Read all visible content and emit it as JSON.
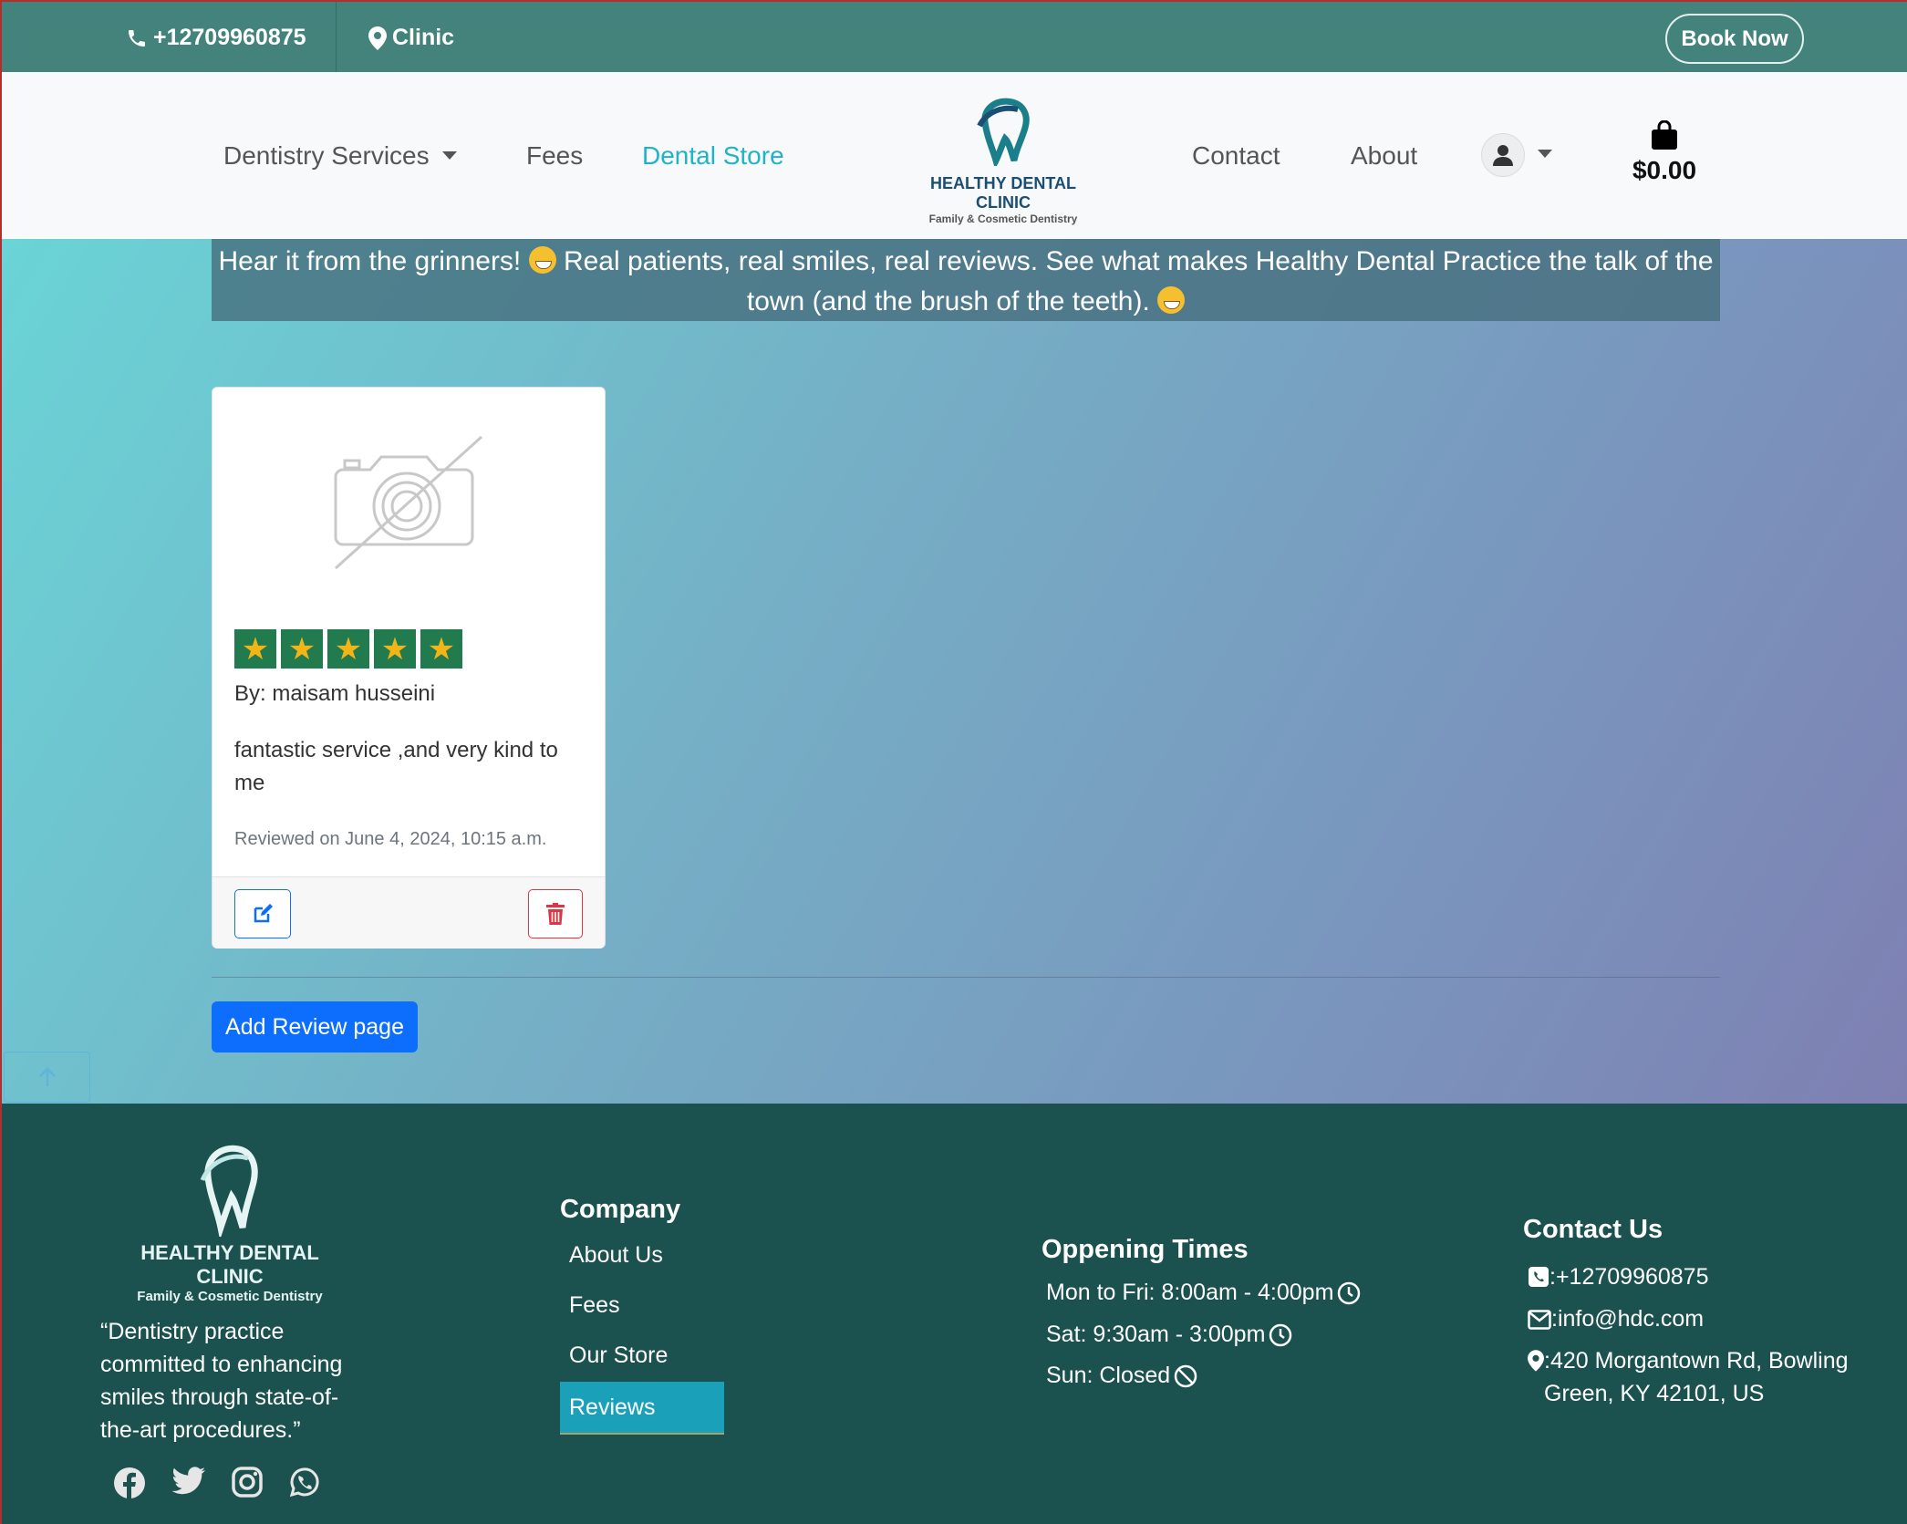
{
  "topbar": {
    "phone": "+12709960875",
    "location": "Clinic",
    "book_label": "Book Now"
  },
  "nav": {
    "services": "Dentistry Services",
    "fees": "Fees",
    "store": "Dental Store",
    "contact": "Contact",
    "about": "About",
    "logo_title": "HEALTHY DENTAL CLINIC",
    "logo_subtitle": "Family & Cosmetic Dentistry",
    "cart_total": "$0.00"
  },
  "banner": {
    "part1": "Hear it from the grinners! ",
    "part2": " Real patients, real smiles, real reviews. See what makes Healthy Dental Practice the talk of the town (and the brush of the teeth). "
  },
  "reviews": [
    {
      "rating": 5,
      "author": "By: maisam husseini",
      "text": "fantastic service ,and very kind to me",
      "date": "Reviewed on June 4, 2024, 10:15 a.m."
    }
  ],
  "add_review_label": "Add Review page",
  "footer": {
    "logo_title": "HEALTHY DENTAL CLINIC",
    "logo_subtitle": "Family & Cosmetic Dentistry",
    "quote": "“Dentistry practice committed to enhancing smiles through state-of-the-art procedures.”",
    "company_title": "Company",
    "links": [
      "About Us",
      "Fees",
      "Our Store",
      "Reviews"
    ],
    "hours_title": "Oppening Times",
    "hours": [
      "Mon to Fri: 8:00am - 4:00pm",
      "Sat: 9:30am - 3:00pm",
      "Sun: Closed"
    ],
    "contact_title": "Contact Us",
    "contact_phone": ":+12709960875",
    "contact_email": ":info@hdc.com",
    "contact_address": ":420 Morgantown Rd, Bowling Green, KY 42101, US"
  },
  "colors": {
    "topbar": "#43837b",
    "footer": "#1b514e",
    "accent": "#1fb3c9",
    "primary": "#0d6efd"
  }
}
